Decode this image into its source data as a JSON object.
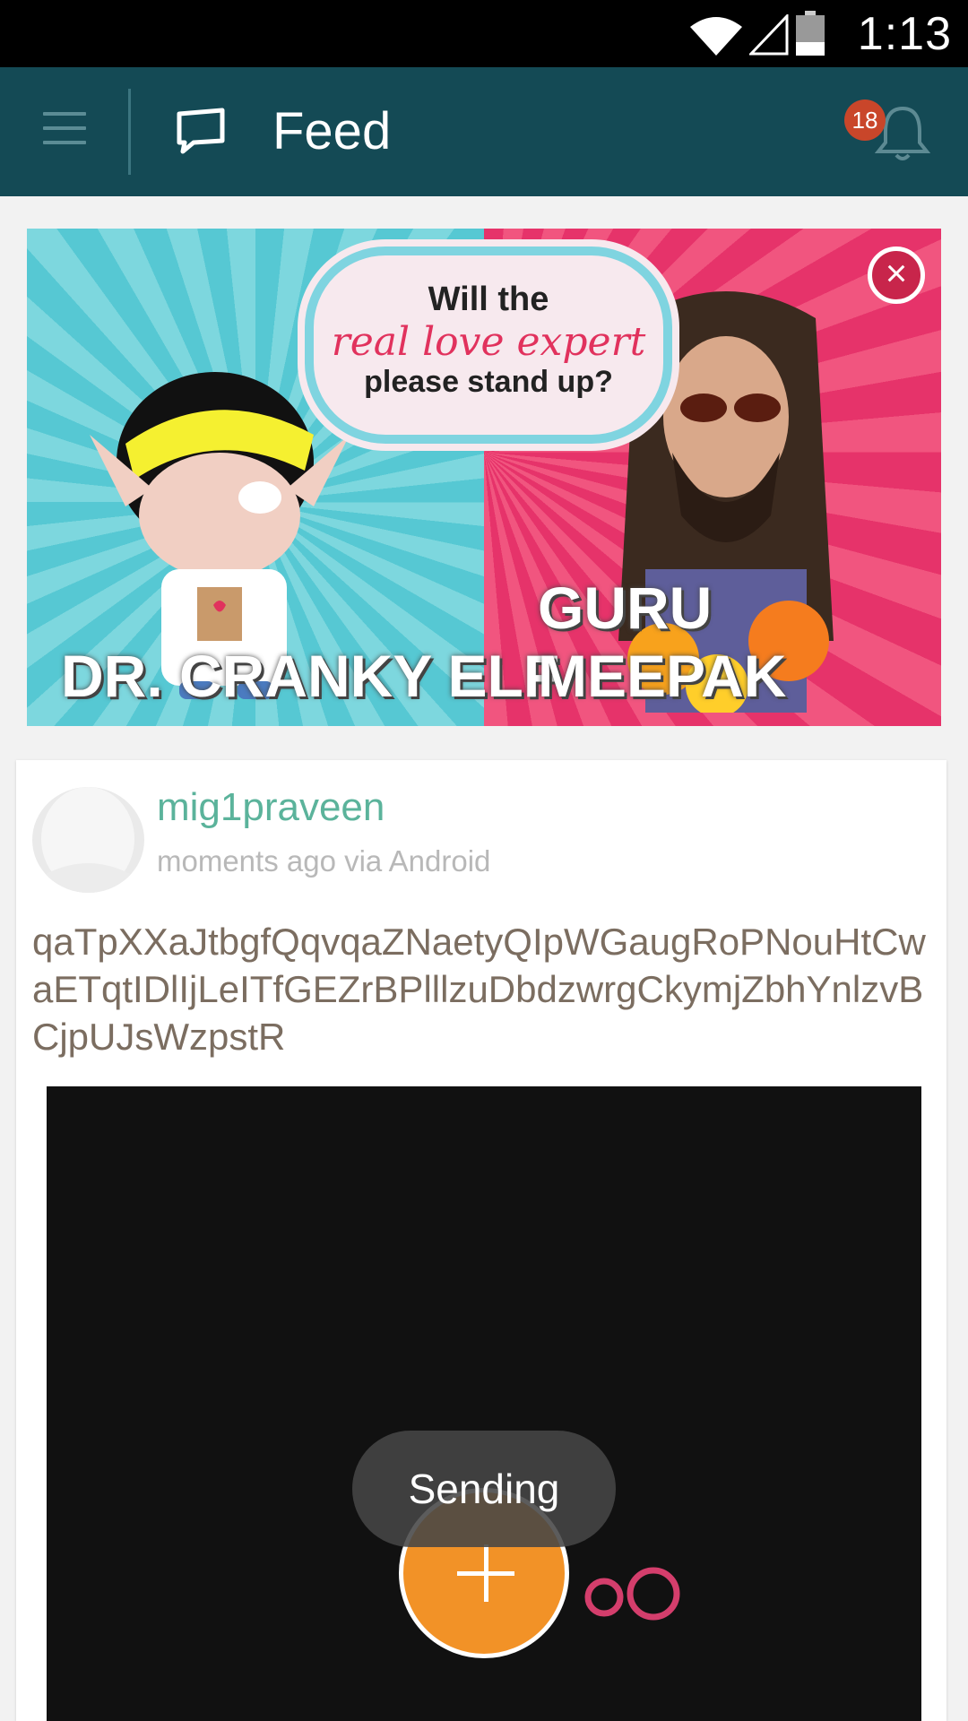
{
  "status_bar": {
    "time": "1:13",
    "icons": [
      "wifi-icon",
      "signal-icon",
      "battery-icon"
    ]
  },
  "app_bar": {
    "title": "Feed",
    "notification_count": "18",
    "background": "#144a55"
  },
  "banner": {
    "headline_line1": "Will the",
    "headline_line2": "real love expert",
    "headline_line3": "please stand up?",
    "left_caption": "DR. CRANKY ELF",
    "right_caption": "GURU MEEPAK",
    "close_label": "×"
  },
  "post": {
    "username": "mig1praveen",
    "meta": "moments ago via Android",
    "text": "qaTpXXaJtbgfQqvqaZNaetyQIpWGaugRoPNouHtCwaETqtIDlIjLeITfGEZrBPlllzuDbdzwrgCkymjZbhYnlzvBCjpUJsWzpstR"
  },
  "toast": {
    "text": "Sending"
  },
  "colors": {
    "accent": "#f29227",
    "username": "#5bb39b",
    "badge": "#c9462a"
  }
}
